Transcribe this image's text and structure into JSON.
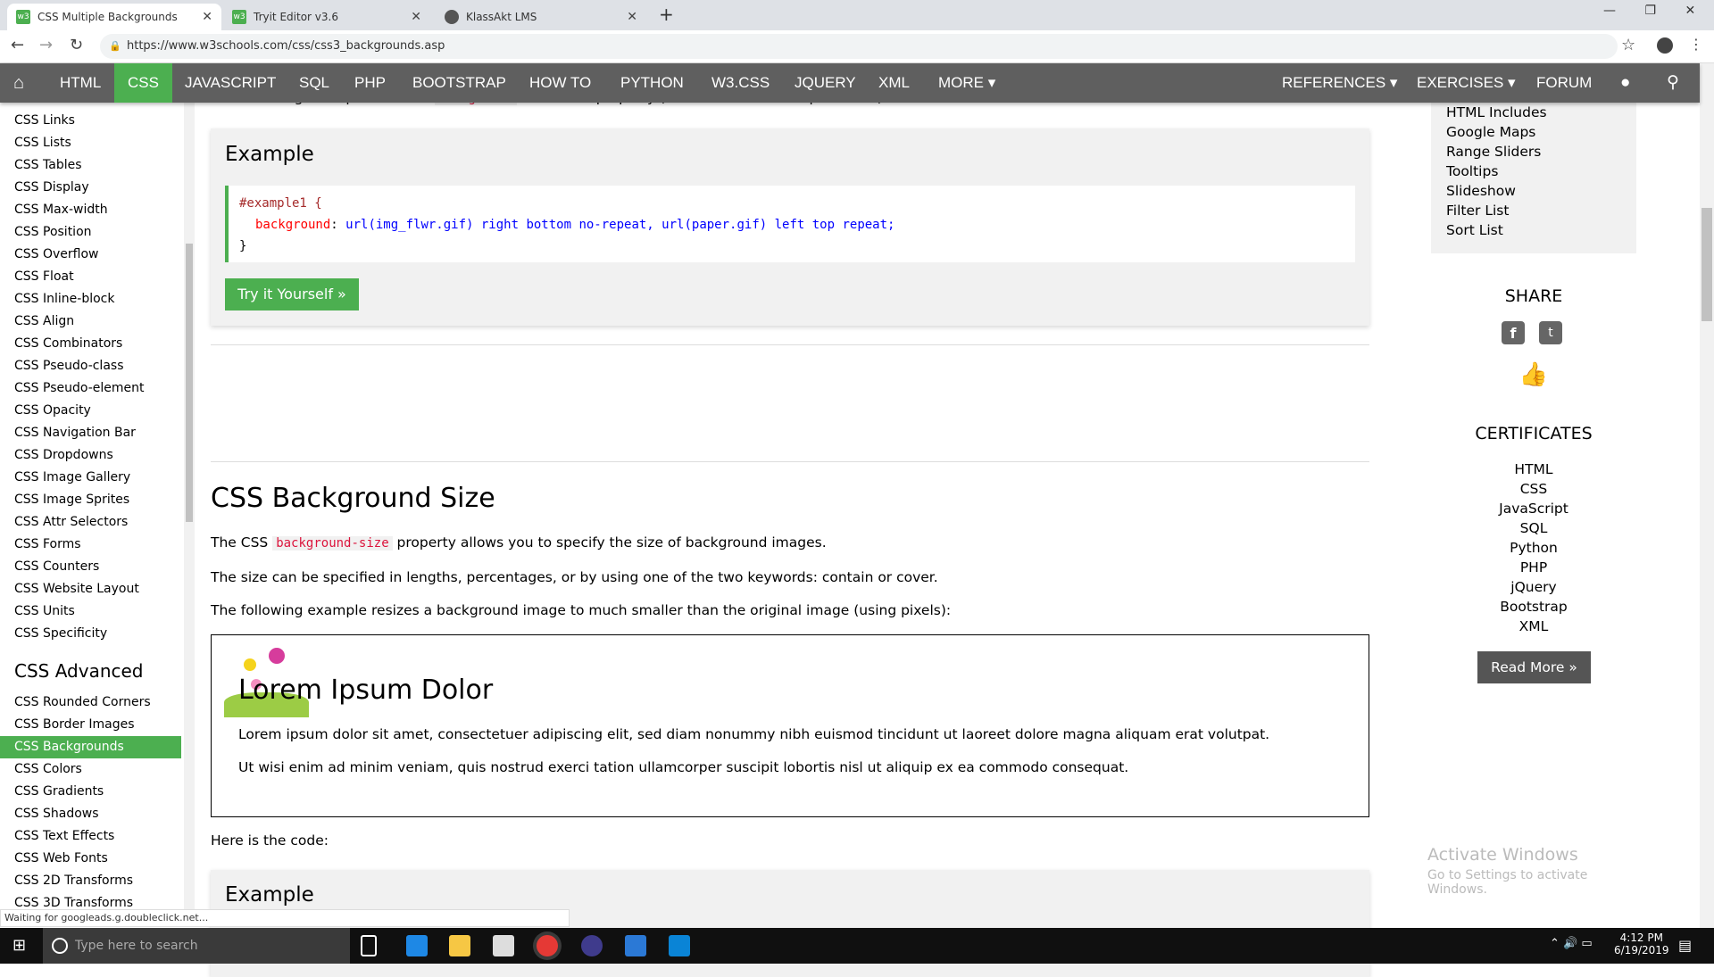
{
  "browser": {
    "tabs": [
      {
        "label": "CSS Multiple Backgrounds",
        "icon": "w3-icon"
      },
      {
        "label": "Tryit Editor v3.6",
        "icon": "w3-icon"
      },
      {
        "label": "KlassAkt LMS",
        "icon": "globe-icon"
      }
    ],
    "url": "https://www.w3schools.com/css/css3_backgrounds.asp",
    "status": "Waiting for googleads.g.doubleclick.net..."
  },
  "nav": {
    "left": [
      "HTML",
      "CSS",
      "JAVASCRIPT",
      "SQL",
      "PHP",
      "BOOTSTRAP",
      "HOW TO",
      "PYTHON",
      "W3.CSS",
      "JQUERY",
      "XML",
      "MORE ▾"
    ],
    "right": [
      "REFERENCES ▾",
      "EXERCISES ▾",
      "FORUM"
    ]
  },
  "sidebar": {
    "items": [
      "CSS Links",
      "CSS Lists",
      "CSS Tables",
      "CSS Display",
      "CSS Max-width",
      "CSS Position",
      "CSS Overflow",
      "CSS Float",
      "CSS Inline-block",
      "CSS Align",
      "CSS Combinators",
      "CSS Pseudo-class",
      "CSS Pseudo-element",
      "CSS Opacity",
      "CSS Navigation Bar",
      "CSS Dropdowns",
      "CSS Image Gallery",
      "CSS Image Sprites",
      "CSS Attr Selectors",
      "CSS Forms",
      "CSS Counters",
      "CSS Website Layout",
      "CSS Units",
      "CSS Specificity"
    ],
    "advanced_heading": "CSS Advanced",
    "advanced": [
      "CSS Rounded Corners",
      "CSS Border Images",
      "CSS Backgrounds",
      "CSS Colors",
      "CSS Gradients",
      "CSS Shadows",
      "CSS Text Effects",
      "CSS Web Fonts",
      "CSS 2D Transforms",
      "CSS 3D Transforms"
    ],
    "active": "CSS Backgrounds"
  },
  "main": {
    "intro_pre": "The following example uses the ",
    "intro_kw": "background",
    "intro_post": " shorthand property (same result as example above):",
    "example_title": "Example",
    "code": {
      "selector": "#example1 {",
      "prop": "background",
      "value": " url(img_flwr.gif) right bottom no-repeat, url(paper.gif) left top repeat;",
      "close": "}"
    },
    "try_label": "Try it Yourself »",
    "h2": "CSS Background Size",
    "p1_pre": "The CSS ",
    "p1_kw": "background-size",
    "p1_post": " property allows you to specify the size of background images.",
    "p2": "The size can be specified in lengths, percentages, or by using one of the two keywords: contain or cover.",
    "p3": "The following example resizes a background image to much smaller than the original image (using pixels):",
    "demo": {
      "heading": "Lorem Ipsum Dolor",
      "p1": "Lorem ipsum dolor sit amet, consectetuer adipiscing elit, sed diam nonummy nibh euismod tincidunt ut laoreet dolore magna aliquam erat volutpat.",
      "p2": "Ut wisi enim ad minim veniam, quis nostrud exerci tation ullamcorper suscipit lobortis nisl ut aliquip ex ea commodo consequat."
    },
    "here_code": "Here is the code:",
    "example_title2": "Example"
  },
  "right": {
    "links": [
      "HTML Includes",
      "Google Maps",
      "Range Sliders",
      "Tooltips",
      "Slideshow",
      "Filter List",
      "Sort List"
    ],
    "share": "SHARE",
    "certificates": "CERTIFICATES",
    "certs": [
      "HTML",
      "CSS",
      "JavaScript",
      "SQL",
      "Python",
      "PHP",
      "jQuery",
      "Bootstrap",
      "XML"
    ],
    "read_more": "Read More »",
    "activate1": "Activate Windows",
    "activate2": "Go to Settings to activate Windows."
  },
  "taskbar": {
    "search_placeholder": "Type here to search",
    "time": "4:12 PM",
    "date": "6/19/2019"
  },
  "colors": {
    "accent": "#4caf50",
    "nav": "#5f5f5f"
  }
}
